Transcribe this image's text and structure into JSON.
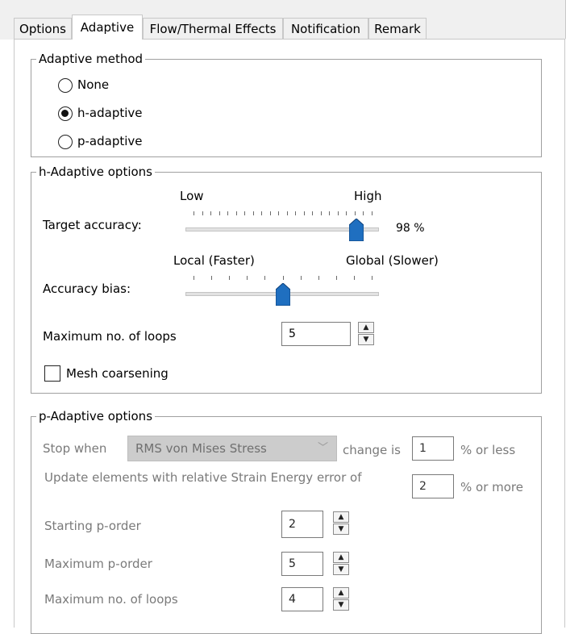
{
  "tabs": [
    {
      "label": "Options",
      "active": false
    },
    {
      "label": "Adaptive",
      "active": true
    },
    {
      "label": "Flow/Thermal Effects",
      "active": false
    },
    {
      "label": "Notification",
      "active": false
    },
    {
      "label": "Remark",
      "active": false
    }
  ],
  "adaptive_method": {
    "title": "Adaptive method",
    "options": [
      {
        "label": "None",
        "selected": false
      },
      {
        "label": "h-adaptive",
        "selected": true
      },
      {
        "label": "p-adaptive",
        "selected": false
      }
    ]
  },
  "h_adaptive": {
    "title": "h-Adaptive options",
    "target_accuracy": {
      "label": "Target accuracy:",
      "min_label": "Low",
      "max_label": "High",
      "value_text": "98 %",
      "value": 0.91
    },
    "accuracy_bias": {
      "label": "Accuracy bias:",
      "min_label": "Local (Faster)",
      "max_label": "Global (Slower)",
      "value": 0.5
    },
    "max_loops": {
      "label": "Maximum no. of loops",
      "value": "5"
    },
    "mesh_coarsening": {
      "label": "Mesh coarsening",
      "checked": false
    }
  },
  "p_adaptive": {
    "title": "p-Adaptive options",
    "stop_when": {
      "label": "Stop when",
      "selected": "RMS von Mises Stress",
      "change_label": "change is",
      "value": "1",
      "suffix": "% or less"
    },
    "update_elements": {
      "label": "Update elements with relative Strain Energy error of",
      "value": "2",
      "suffix": "% or more"
    },
    "starting_p_order": {
      "label": "Starting p-order",
      "value": "2"
    },
    "maximum_p_order": {
      "label": "Maximum p-order",
      "value": "5"
    },
    "max_loops": {
      "label": "Maximum no. of loops",
      "value": "4"
    }
  }
}
